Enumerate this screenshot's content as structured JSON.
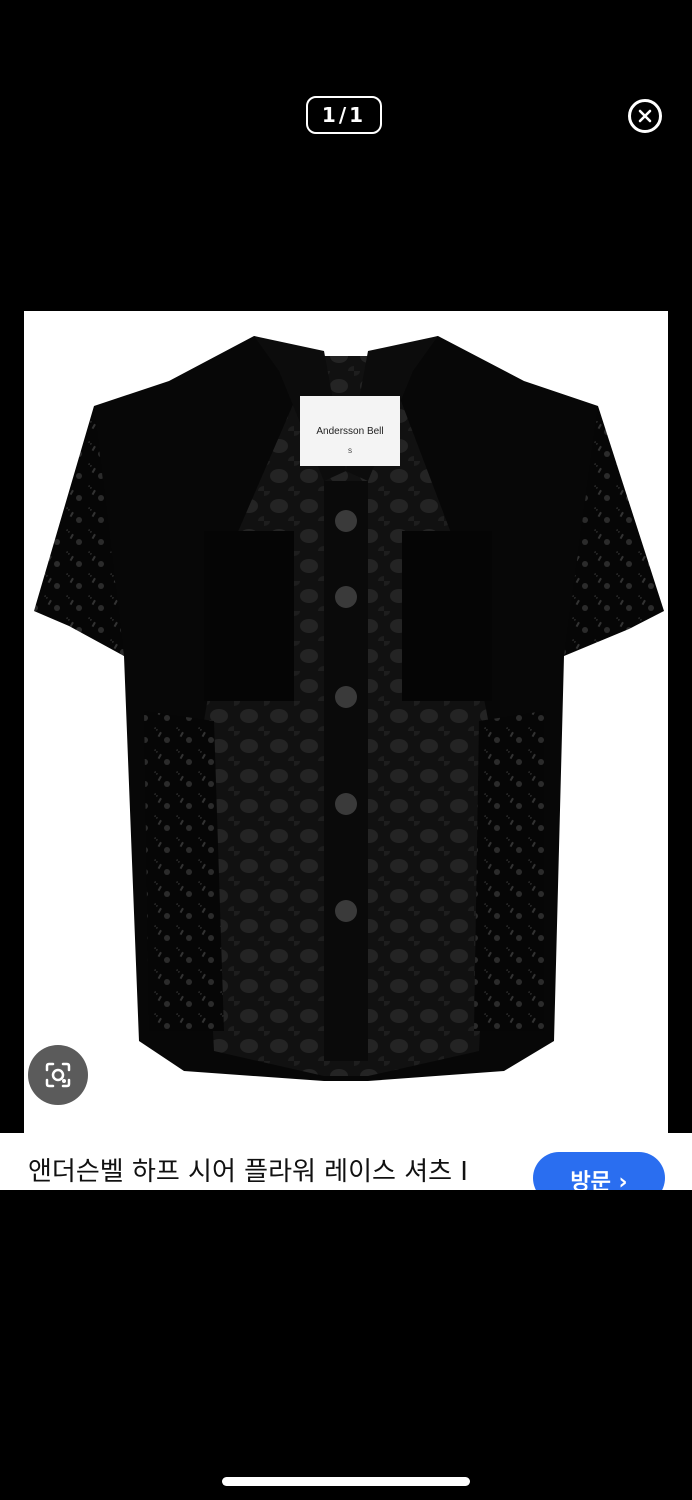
{
  "viewer": {
    "counter": "1/1",
    "close_icon": "close-circle-icon"
  },
  "product_image": {
    "label_brand": "Andersson Bell",
    "label_size": "S"
  },
  "lens_icon": "visual-search-lens-icon",
  "caption": {
    "title": "앤더슨벨 하프 시어 플라워 레이스 셔츠 I",
    "visit_label": "방문 ›"
  },
  "colors": {
    "background": "#000000",
    "visit_button": "#2a6ef0"
  }
}
